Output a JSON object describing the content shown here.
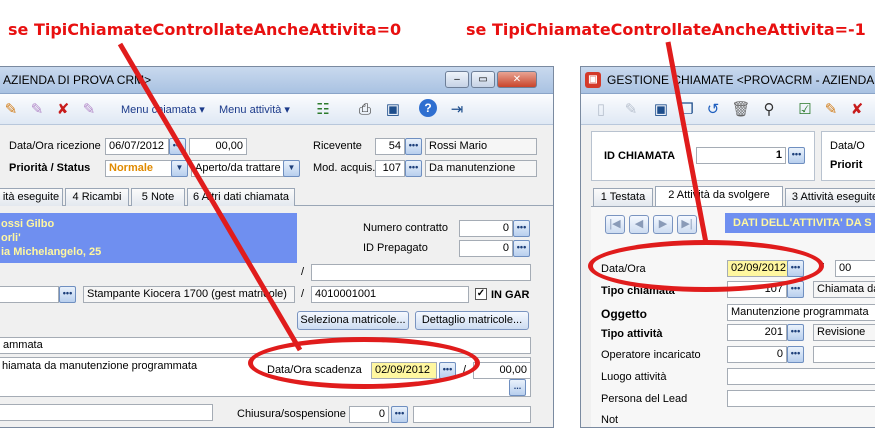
{
  "captions": {
    "left": "se TipiChiamateControllateAncheAttivita=0",
    "right": "se TipiChiamateControllateAncheAttivita=-1"
  },
  "left_window": {
    "title": "AZIENDA DI PROVA CRM>",
    "menu_chiamata": "Menu chiamata",
    "menu_attivita": "Menu attività",
    "data_ora_ricezione_label": "Data/Ora ricezione",
    "data_ricezione_value": "06/07/2012",
    "ora_ricezione_value": "00,00",
    "priorita_status_label": "Priorità / Status",
    "priorita_value": "Normale",
    "status_value": "Aperto/da trattare",
    "ricevente_label": "Ricevente",
    "ricevente_code": "54",
    "ricevente_name": "Rossi Mario",
    "mod_acquis_label": "Mod. acquis.",
    "mod_acquis_code": "107",
    "mod_acquis_name": "Da manutenzione",
    "tabs": [
      "ità eseguite",
      "4 Ricambi",
      "5 Note",
      "6 Altri dati chiamata"
    ],
    "customer_lines": [
      "ossi Gilbo",
      "orli'",
      "ia Michelangelo, 25"
    ],
    "numero_contratto_label": "Numero contratto",
    "numero_contratto_value": "0",
    "id_prepagato_label": "ID Prepagato",
    "id_prepagato_value": "0",
    "slash": "/",
    "product_desc": "Stampante Kiocera 1700  (gest matricole)",
    "matricola_value": "4010001001",
    "in_garanzia_label": "IN GAR",
    "seleziona_matricole": "Seleziona matricole...",
    "dettaglio_matricole": "Dettaglio matricole...",
    "oggetto_partial": "ammata",
    "descrizione_partial": "hiamata da manutenzione programmata",
    "data_ora_scadenza_label": "Data/Ora scadenza",
    "data_scadenza_value": "02/09/2012",
    "ora_scadenza_value": "00,00",
    "more_button": "...",
    "chiusura_label": "Chiusura/sospensione",
    "chiusura_value": "0"
  },
  "right_window": {
    "title": "GESTIONE CHIAMATE <PROVACRM - AZIENDA D",
    "id_chiamata_label": "ID CHIAMATA",
    "id_chiamata_value": "1",
    "data_ora_partial": "Data/O",
    "priorita_partial": "Priorit",
    "tabs": [
      "1 Testata",
      "2 Attività da svolgere",
      "3 Attività eseguite"
    ],
    "section_header": "DATI DELL'ATTIVITA' DA S",
    "data_ora_label": "Data/Ora",
    "data_value": "02/09/2012",
    "ora_partial": "00",
    "tipo_chiamata_label": "Tipo chiamata",
    "tipo_chiamata_code": "107",
    "tipo_chiamata_name": "Chiamata da",
    "oggetto_label": "Oggetto",
    "oggetto_value": "Manutenzione programmata",
    "tipo_attivita_label": "Tipo attività",
    "tipo_attivita_code": "201",
    "tipo_attivita_name": "Revisione",
    "operatore_label": "Operatore incaricato",
    "operatore_value": "0",
    "luogo_label": "Luogo attività",
    "persona_lead_label": "Persona del Lead",
    "note_partial": "Not"
  },
  "colors": {
    "annotation_red": "#e01c1c",
    "highlight_yellow": "#fff7a0",
    "customer_blue_bg": "#6f8ff0"
  }
}
